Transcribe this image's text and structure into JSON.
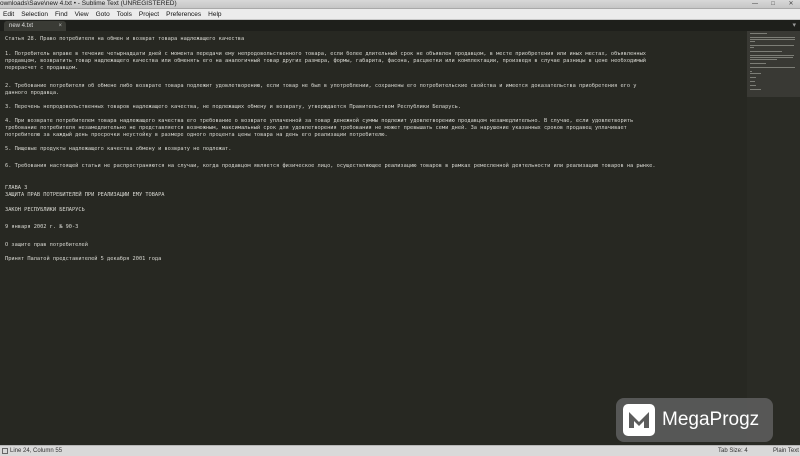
{
  "window": {
    "title": "ownloads\\Save\\new 4.txt • - Sublime Text (UNREGISTERED)",
    "controls": [
      "—",
      "□",
      "✕"
    ]
  },
  "menu": [
    "Edit",
    "Selection",
    "Find",
    "View",
    "Goto",
    "Tools",
    "Project",
    "Preferences",
    "Help"
  ],
  "tabs": [
    {
      "label": "new 4.txt",
      "close": "×"
    }
  ],
  "tab_dropdown": "▾",
  "editor": {
    "lines": [
      "Статья 28. Право потребителя на обмен и возврат товара надлежащего качества",
      "",
      "1. Потребитель вправе в течение четырнадцати дней с момента передачи ему непродовольственного товара, если более длительный срок не объявлен продавцом, в месте приобретения или иных местах, объявленных",
      "продавцом, возвратить товар надлежащего качества или обменять его на аналогичный товар других размера, формы, габарита, фасона, расцветки или комплектации, произведя в случае разницы в цене необходимый",
      "перерасчет с продавцом.",
      "",
      "2. Требование потребителя об обмене либо возврате товара подлежит удовлетворению, если товар не был в употреблении, сохранены его потребительские свойства и имеется доказательства приобретения его у",
      "данного продавца.",
      "",
      "3. Перечень непродовольственных товаров надлежащего качества, не подлежащих обмену и возврату, утверждается Правительством Республики Беларусь.",
      "",
      "4. При возврате потребителем товара надлежащего качества его требование о возврате уплаченной за товар денежной суммы подлежит удовлетворению продавцом незамедлительно. В случае, если удовлетворить",
      "требование потребителя незамедлительно не представляется возможным, максимальный срок для удовлетворения требования не может превышать семи дней. За нарушение указанных сроков продавец уплачивает",
      "потребителю за каждый день просрочки неустойку в размере одного процента цены товара на день его реализации потребителю.",
      "",
      "5. Пищевые продукты надлежащего качества обмену и возврату не подлежат.",
      "",
      "6. Требования настоящей статьи не распространяются на случаи, когда продавцом является физическое лицо, осуществляющее реализацию товаров в рамках ремесленной деятельности или реализацию товаров на рынке.",
      "",
      "ГЛАВА 3",
      "ЗАЩИТА ПРАВ ПОТРЕБИТЕЛЕЙ ПРИ РЕАЛИЗАЦИИ ЕМУ ТОВАРА",
      "",
      "ЗАКОН РЕСПУБЛИКИ БЕЛАРУСЬ",
      "",
      "9 января 2002 г. № 90-З",
      "",
      "О защите прав потребителей",
      "",
      "Принят Палатой представителей 5 декабря 2001 года"
    ]
  },
  "status": {
    "position": "Line 24, Column 55",
    "tab_size": "Tab Size: 4",
    "syntax": "Plain Text"
  },
  "watermark": {
    "text": "MegaProgz",
    "icon": "megaprogz-logo-icon"
  }
}
